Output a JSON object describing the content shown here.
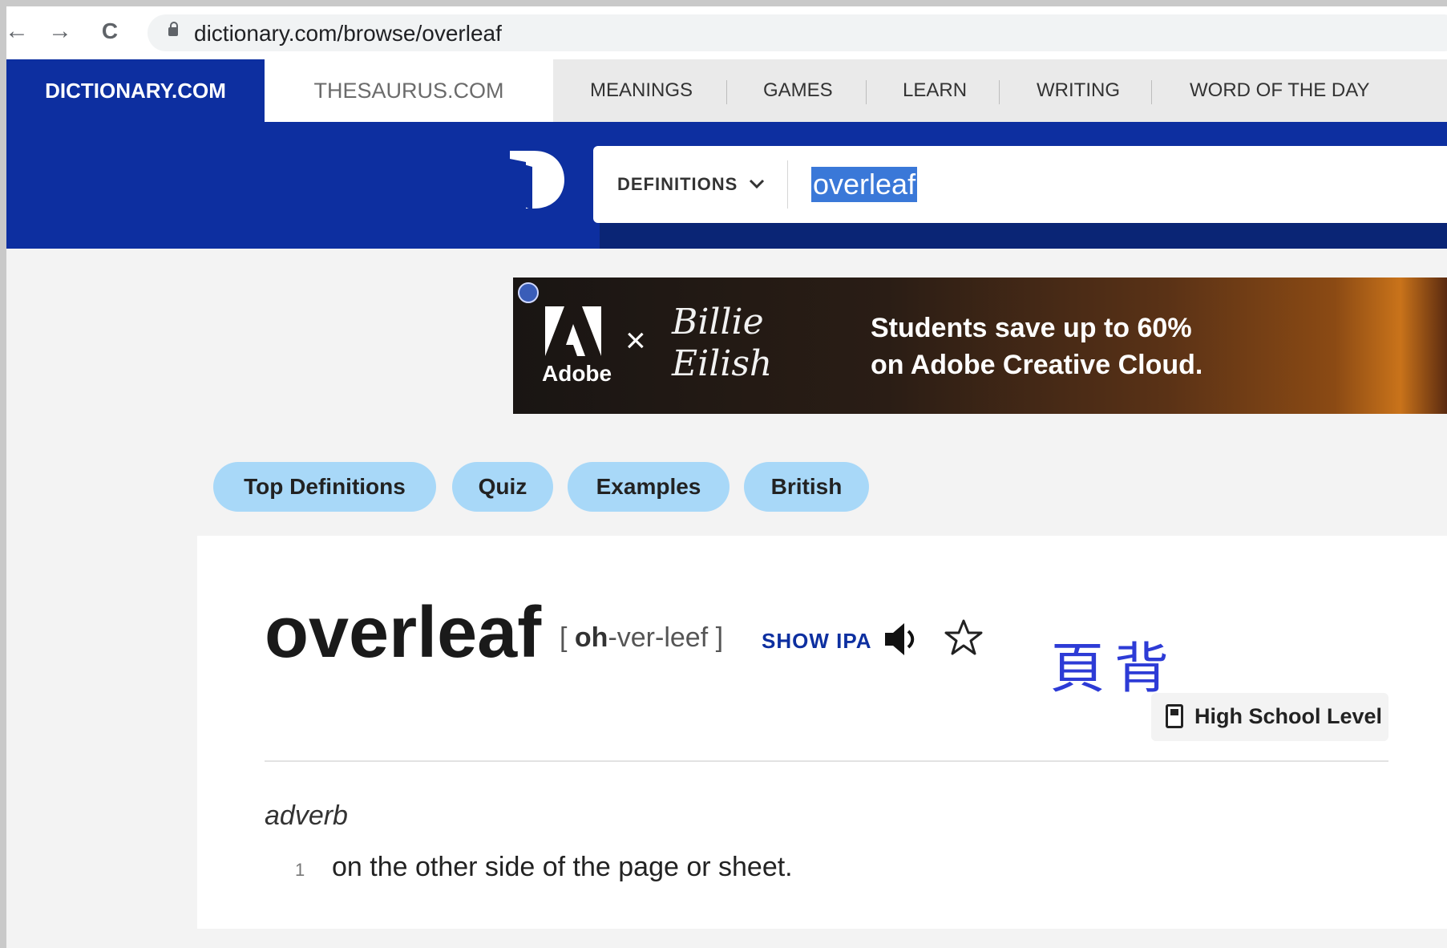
{
  "browser": {
    "url": "dictionary.com/browse/overleaf",
    "back_icon": "←",
    "forward_icon": "→",
    "reload_icon": "C"
  },
  "topnav": {
    "site_tab": "DICTIONARY.COM",
    "thesaurus_tab": "THESAURUS.COM",
    "menu": [
      "MEANINGS",
      "GAMES",
      "LEARN",
      "WRITING",
      "WORD OF THE DAY"
    ]
  },
  "search": {
    "dropdown_label": "DEFINITIONS",
    "query": "overleaf"
  },
  "ad": {
    "adobe_label": "Adobe",
    "x_mark": "×",
    "billie_line1": "Billie",
    "billie_line2": "Eilish",
    "copy_line1": "Students save up to 60%",
    "copy_line2": "on Adobe Creative Cloud."
  },
  "pills": [
    "Top Definitions",
    "Quiz",
    "Examples",
    "British"
  ],
  "entry": {
    "headword": "overleaf",
    "pron_open": "[ ",
    "pron_stress": "oh",
    "pron_rest": "-ver-leef ]",
    "show_ipa": "SHOW IPA",
    "annotation": "頁背",
    "level": "High School Level",
    "part_of_speech": "adverb",
    "definitions": [
      {
        "num": "1",
        "text": "on the other side of the page or sheet."
      }
    ]
  },
  "colors": {
    "brand_blue": "#0d2fa0",
    "pill_blue": "#a8d8f8",
    "annotation_blue": "#2d3bd6"
  }
}
